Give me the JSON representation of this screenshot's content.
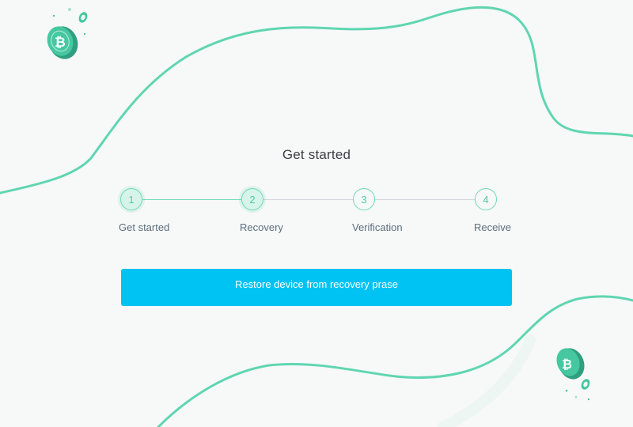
{
  "page": {
    "title": "Get started"
  },
  "stepper": {
    "steps": [
      {
        "number": "1",
        "label": "Get started",
        "state": "completed"
      },
      {
        "number": "2",
        "label": "Recovery",
        "state": "active"
      },
      {
        "number": "3",
        "label": "Verification",
        "state": "pending"
      },
      {
        "number": "4",
        "label": "Receive",
        "state": "pending"
      }
    ]
  },
  "actions": {
    "restore_label": "Restore device from recovery prase"
  },
  "theme": {
    "accent": "#6fd9b6",
    "button": "#00c2f3",
    "background": "#f7f8f8",
    "coin": "#3cbf98"
  },
  "decorations": {
    "coin_top_left_icon": "bitcoin-coin-icon",
    "coin_bottom_right_icon": "bitcoin-coin-icon"
  }
}
